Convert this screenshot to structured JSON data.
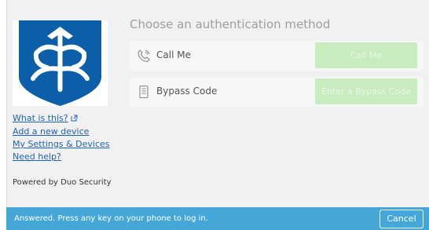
{
  "sidebar": {
    "logo": "depaul-university-shield-logo",
    "links": [
      {
        "label": "What is this?",
        "icon": "external-link-icon"
      },
      {
        "label": "Add a new device"
      },
      {
        "label": "My Settings & Devices"
      },
      {
        "label": "Need help?"
      }
    ],
    "powered_by": "Powered by Duo Security"
  },
  "main": {
    "heading": "Choose an authentication method",
    "methods": [
      {
        "label": "Call Me",
        "icon": "phone-icon",
        "button": "Call Me"
      },
      {
        "label": "Bypass Code",
        "icon": "document-icon",
        "button": "Enter a Bypass Code"
      }
    ]
  },
  "status_bar": {
    "message": "Answered. Press any key on your phone to log in.",
    "cancel_label": "Cancel"
  },
  "colors": {
    "background": "#f1f1f1",
    "logo_blue": "#0b5fa8",
    "button_green_disabled": "#c8ebc0",
    "status_blue": "#45a6d8",
    "link": "#1f63b8"
  }
}
